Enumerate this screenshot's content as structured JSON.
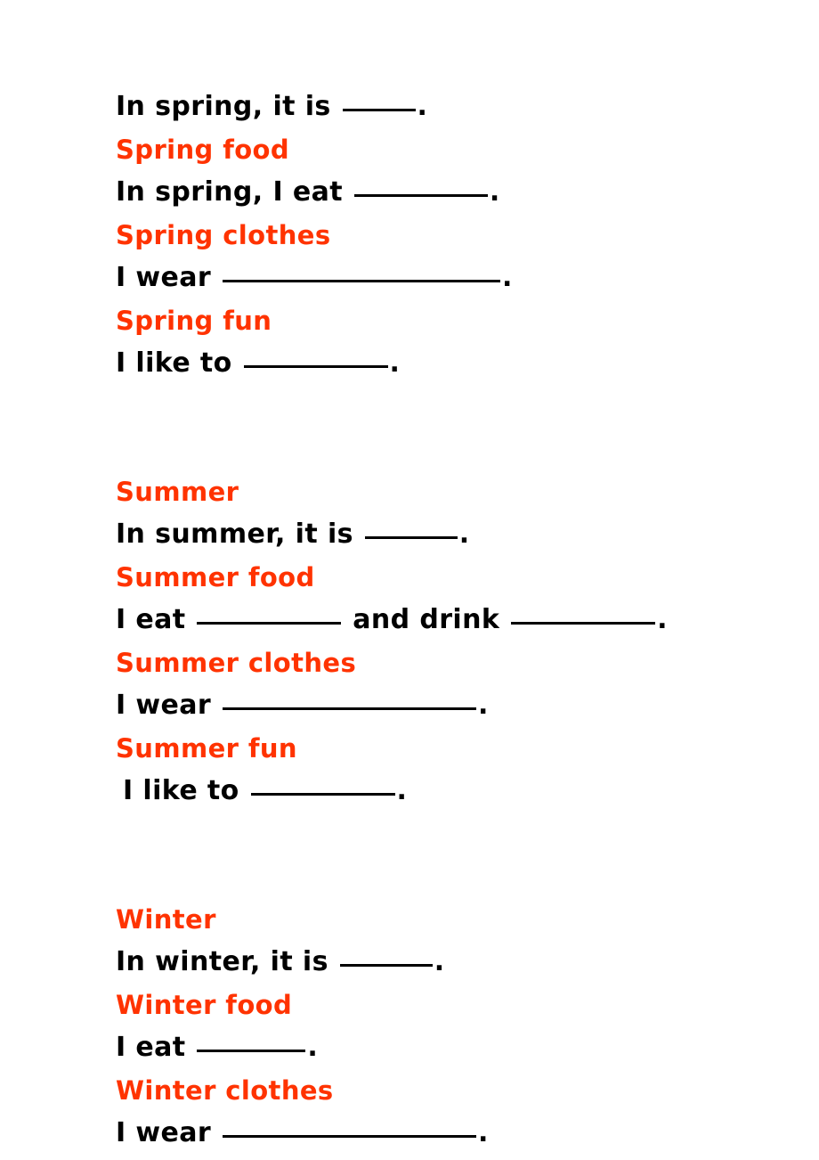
{
  "document": {
    "type": "fill-in-the-blank worksheet",
    "heading_color": "#FF3300",
    "body_color": "#000000",
    "background_color": "#FFFFFF"
  },
  "lines": [
    {
      "id": "l01",
      "style": "sentence",
      "before": "In spring, it is ",
      "blank": "____",
      "after": "."
    },
    {
      "id": "l02",
      "style": "heading",
      "text": "Spring food"
    },
    {
      "id": "l03",
      "style": "sentence",
      "before": "In spring, I eat ",
      "blank": "_______",
      "after": "."
    },
    {
      "id": "l04",
      "style": "heading",
      "text": "Spring clothes"
    },
    {
      "id": "l05",
      "style": "sentence",
      "before": "I wear ",
      "blank": "_________________",
      "after": "."
    },
    {
      "id": "l06",
      "style": "heading",
      "text": "Spring fun"
    },
    {
      "id": "l07",
      "style": "sentence",
      "before": "I like to ",
      "blank": "_________",
      "after": "."
    },
    {
      "id": "l08",
      "style": "heading",
      "text": "Summer"
    },
    {
      "id": "l09",
      "style": "sentence",
      "before": "In summer, it is ",
      "blank": "_____",
      "after": "."
    },
    {
      "id": "l10",
      "style": "heading",
      "text": "Summer food"
    },
    {
      "id": "l11",
      "style": "sentence",
      "before": "I eat ",
      "blank": "________",
      "middle": " and drink ",
      "blank2": "________",
      "after": "."
    },
    {
      "id": "l12",
      "style": "heading",
      "text": "Summer clothes"
    },
    {
      "id": "l13",
      "style": "sentence",
      "before": "I wear ",
      "blank": "_______________",
      "after": "."
    },
    {
      "id": "l14",
      "style": "heading",
      "text": "Summer fun"
    },
    {
      "id": "l15",
      "style": "sentence",
      "before": "I like to ",
      "blank": "________",
      "after": "."
    },
    {
      "id": "l16",
      "style": "heading",
      "text": "Winter"
    },
    {
      "id": "l17",
      "style": "sentence",
      "before": "In winter, it is ",
      "blank": "_____",
      "after": "."
    },
    {
      "id": "l18",
      "style": "heading",
      "text": "Winter food"
    },
    {
      "id": "l19",
      "style": "sentence",
      "before": "I eat ",
      "blank": "______",
      "after": "."
    },
    {
      "id": "l20",
      "style": "heading",
      "text": "Winter clothes"
    },
    {
      "id": "l21",
      "style": "sentence",
      "before": "I wear ",
      "blank": "_______________",
      "after": "."
    }
  ],
  "spring": {
    "weather_sentence": {
      "before": "In spring, it is ",
      "after": "."
    },
    "food_heading": "Spring food",
    "food_sentence": {
      "before": "In spring, I eat ",
      "after": "."
    },
    "clothes_heading": "Spring clothes",
    "clothes_sentence": {
      "before": "I wear ",
      "after": "."
    },
    "fun_heading": "Spring fun",
    "fun_sentence": {
      "before": "I like to ",
      "after": "."
    }
  },
  "summer": {
    "season_heading": "Summer",
    "weather_sentence": {
      "before": "In summer, it is ",
      "after": "."
    },
    "food_heading": "Summer food",
    "food_sentence": {
      "before": "I eat ",
      "middle": " and drink ",
      "after": "."
    },
    "clothes_heading": "Summer clothes",
    "clothes_sentence": {
      "before": "I wear ",
      "after": "."
    },
    "fun_heading": "Summer fun",
    "fun_sentence": {
      "before": "I like to ",
      "after": "."
    }
  },
  "winter": {
    "season_heading": "Winter",
    "weather_sentence": {
      "before": "In winter, it is ",
      "after": "."
    },
    "food_heading": "Winter food",
    "food_sentence": {
      "before": "I eat ",
      "after": "."
    },
    "clothes_heading": "Winter clothes",
    "clothes_sentence": {
      "before": "I wear ",
      "after": "."
    }
  }
}
